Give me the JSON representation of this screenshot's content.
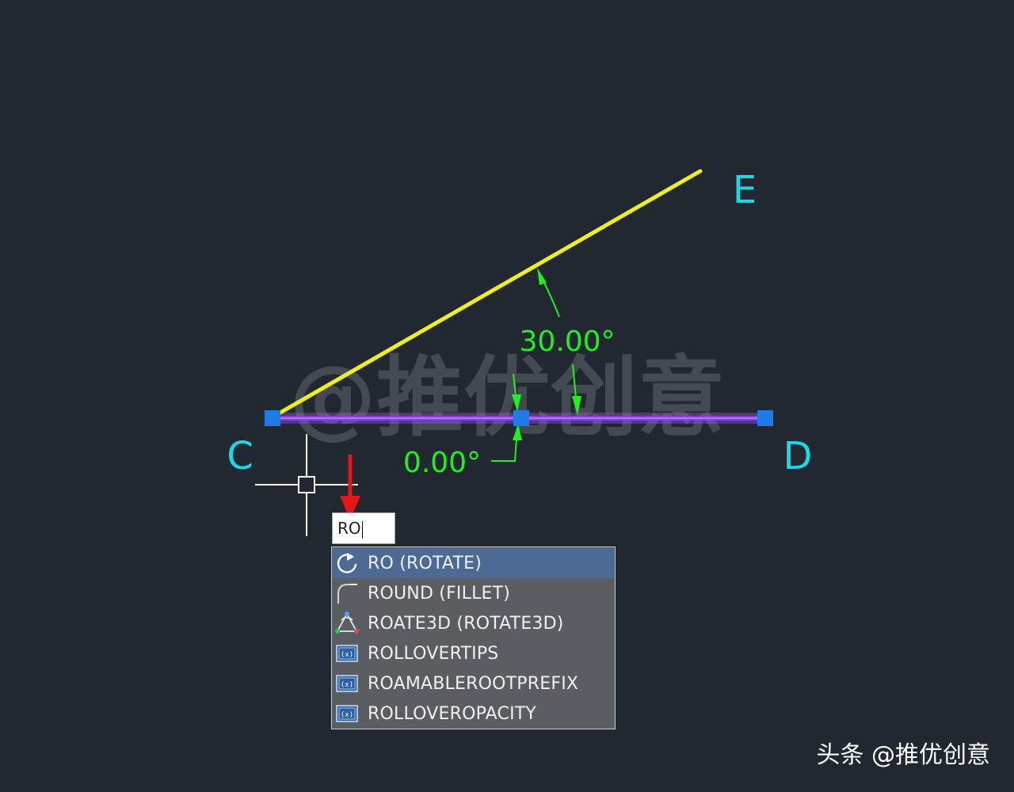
{
  "drawing": {
    "point_labels": {
      "c": "C",
      "d": "D",
      "e": "E"
    },
    "dimensions": {
      "angle_upper": "30.00°",
      "angle_lower": "0.00°"
    },
    "colors": {
      "background": "#212830",
      "line_ce": "#f0ee1c",
      "line_cd": "#8a3cf0",
      "grip": "#1e7be8",
      "point_label": "#19d9e8",
      "dimension": "#22ee22",
      "annotation_arrow": "#e51616"
    }
  },
  "command_line": {
    "input_value": "RO"
  },
  "suggestions": [
    {
      "label": "RO (ROTATE)",
      "icon": "rotate-icon",
      "selected": true
    },
    {
      "label": "ROUND (FILLET)",
      "icon": "fillet-icon",
      "selected": false
    },
    {
      "label": "ROATE3D (ROTATE3D)",
      "icon": "rotate3d-icon",
      "selected": false
    },
    {
      "label": "ROLLOVERTIPS",
      "icon": "system-variable-icon",
      "selected": false
    },
    {
      "label": "ROAMABLEROOTPREFIX",
      "icon": "system-variable-icon",
      "selected": false
    },
    {
      "label": "ROLLOVEROPACITY",
      "icon": "system-variable-icon",
      "selected": false
    }
  ],
  "watermark": {
    "center_text": "@推优创意",
    "footer_text": "头条 @推优创意"
  }
}
